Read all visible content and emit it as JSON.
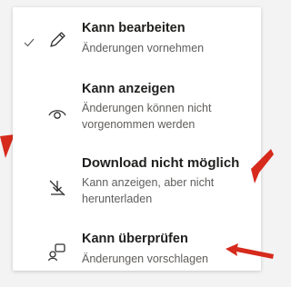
{
  "menu": {
    "items": [
      {
        "title": "Kann bearbeiten",
        "description": "Änderungen vornehmen",
        "icon": "pencil-icon",
        "selected": true
      },
      {
        "title": "Kann anzeigen",
        "description": "Änderungen können nicht vorgenommen werden",
        "icon": "eye-icon",
        "selected": false
      },
      {
        "title": "Download nicht möglich",
        "description": "Kann anzeigen, aber nicht herunterladen",
        "icon": "download-blocked-icon",
        "selected": false
      },
      {
        "title": "Kann überprüfen",
        "description": "Änderungen vorschlagen",
        "icon": "review-icon",
        "selected": false
      }
    ]
  },
  "colors": {
    "annotation_arrow": "#d62a1c",
    "title_text": "#201f1e",
    "description_text": "#605e5c"
  }
}
